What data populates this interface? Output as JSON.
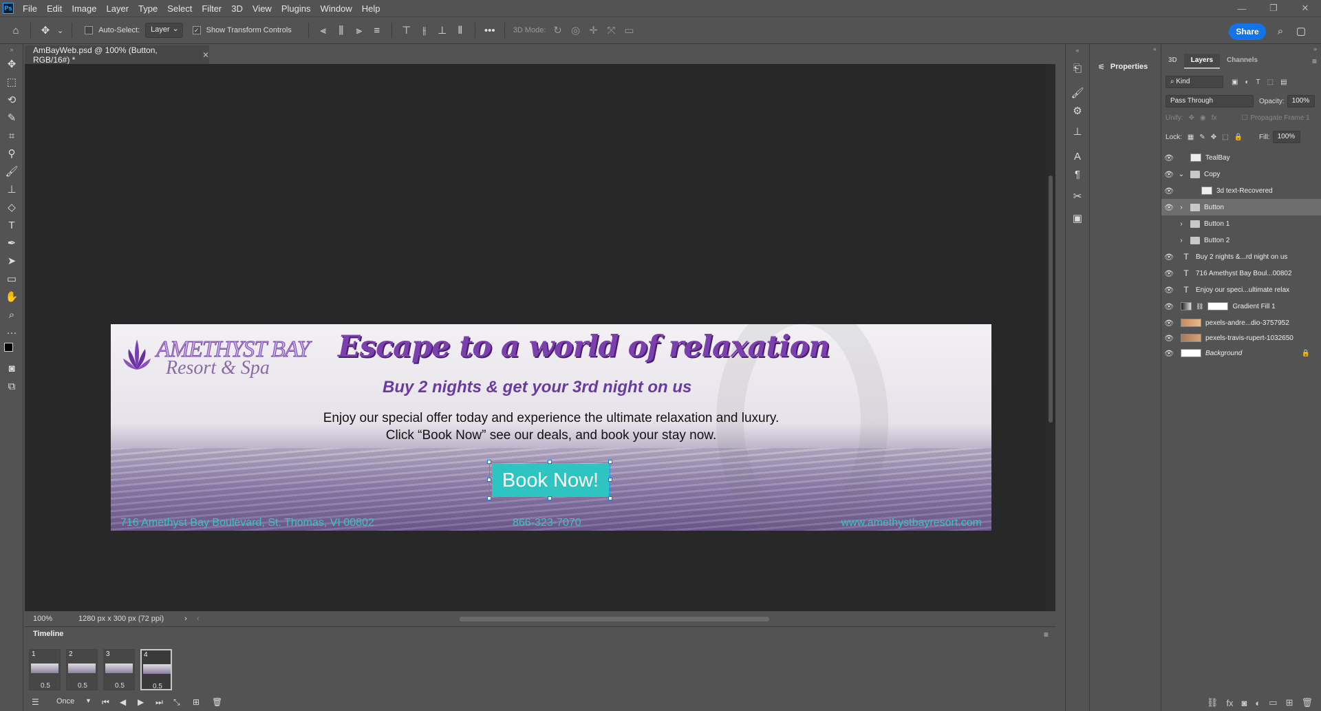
{
  "app": {
    "logo": "Ps"
  },
  "menu": [
    "File",
    "Edit",
    "Image",
    "Layer",
    "Type",
    "Select",
    "Filter",
    "3D",
    "View",
    "Plugins",
    "Window",
    "Help"
  ],
  "window_controls": [
    "—",
    "❐",
    "✕"
  ],
  "options_bar": {
    "auto_select_label": "Auto-Select:",
    "auto_select_value": "Layer",
    "show_transform_label": "Show Transform Controls",
    "mode_3d_label": "3D Mode:",
    "share_label": "Share"
  },
  "tools": [
    "move-tool",
    "marquee-tool",
    "lasso-tool",
    "quick-select-tool",
    "crop-tool",
    "eyedropper-tool",
    "brush-tool",
    "stamp-tool",
    "eraser-tool",
    "type-tool",
    "pen-tool",
    "path-select-tool",
    "rectangle-tool",
    "hand-tool",
    "zoom-tool",
    "more-tools"
  ],
  "document": {
    "tab_title": "AmBayWeb.psd @ 100% (Button, RGB/16#) *",
    "zoom": "100%",
    "doc_info": "1280 px x 300 px (72 ppi)"
  },
  "banner": {
    "logo_title": "AMETHYST BAY",
    "logo_subtitle": "Resort & Spa",
    "headline": "Escape to a world of  relaxation",
    "subhead": "Buy 2 nights & get your 3rd night on us",
    "body": "Enjoy our special offer today and experience the ultimate relaxation and luxury. Click “Book Now” see our deals, and book your stay now.",
    "button": "Book Now!",
    "address": "716 Amethyst Bay Boulevard, St. Thomas, VI 00802",
    "phone": "866-323-7070",
    "website": "www.amethystbayresort.com"
  },
  "timeline": {
    "title": "Timeline",
    "frames": [
      {
        "num": "1",
        "delay": "0.5"
      },
      {
        "num": "2",
        "delay": "0.5"
      },
      {
        "num": "3",
        "delay": "0.5"
      },
      {
        "num": "4",
        "delay": "0.5"
      }
    ],
    "loop": "Once"
  },
  "properties": {
    "title": "Properties"
  },
  "layers_panel": {
    "tabs": [
      "3D",
      "Layers",
      "Channels"
    ],
    "active_tab": "Layers",
    "filter_kind": "Kind",
    "blend_mode": "Pass Through",
    "opacity_label": "Opacity:",
    "opacity_value": "100%",
    "unify_label": "Unify:",
    "propagate_label": "Propagate Frame 1",
    "lock_label": "Lock:",
    "fill_label": "Fill:",
    "fill_value": "100%",
    "layers": [
      {
        "name": "TealBay",
        "type": "smart",
        "visible": true,
        "indent": 0
      },
      {
        "name": "Copy",
        "type": "group-open",
        "visible": true,
        "indent": 0
      },
      {
        "name": "3d text-Recovered",
        "type": "smart",
        "visible": true,
        "indent": 1
      },
      {
        "name": "Button",
        "type": "group",
        "visible": true,
        "indent": 0,
        "selected": true
      },
      {
        "name": "Button 1",
        "type": "group",
        "visible": false,
        "indent": 0
      },
      {
        "name": "Button 2",
        "type": "group",
        "visible": false,
        "indent": 0
      },
      {
        "name": "Buy 2 nights &...rd night on us",
        "type": "text",
        "visible": true,
        "indent": 0
      },
      {
        "name": "716 Amethyst Bay Boul...00802",
        "type": "text",
        "visible": true,
        "indent": 0
      },
      {
        "name": "Enjoy our speci...ultimate relax",
        "type": "text",
        "visible": true,
        "indent": 0
      },
      {
        "name": "Gradient Fill 1",
        "type": "fill",
        "visible": true,
        "indent": 0
      },
      {
        "name": "pexels-andre...dio-3757952",
        "type": "image",
        "visible": true,
        "indent": 0
      },
      {
        "name": "pexels-travis-rupert-1032650",
        "type": "image",
        "visible": true,
        "indent": 0
      },
      {
        "name": "Background",
        "type": "background",
        "visible": true,
        "indent": 0
      }
    ]
  }
}
